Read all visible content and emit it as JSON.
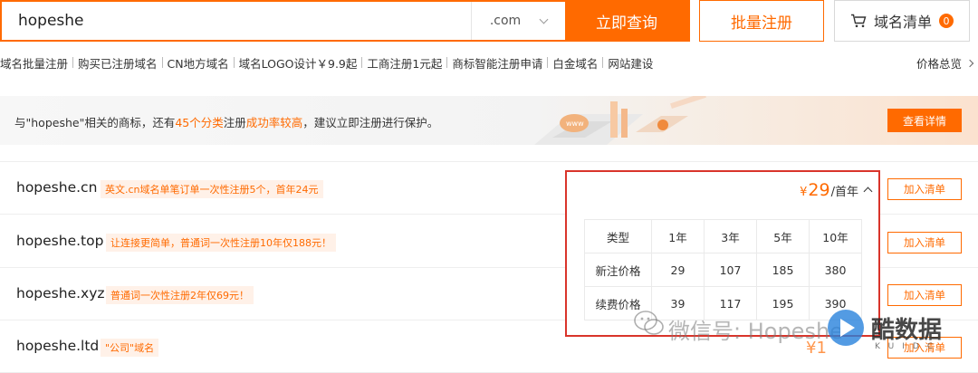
{
  "search": {
    "value": "hopeshe",
    "suffix": ".com",
    "submit_label": "立即查询"
  },
  "header": {
    "batch_label": "批量注册",
    "list_label": "域名清单",
    "list_count": "0"
  },
  "nav": {
    "items": [
      "域名批量注册",
      "购买已注册域名",
      "CN地方域名",
      "域名LOGO设计￥9.9起",
      "工商注册1元起",
      "商标智能注册申请",
      "白金域名",
      "网站建设"
    ],
    "price_overview": "价格总览"
  },
  "banner": {
    "text_before": "与\"hopeshe\"相关的商标，还有",
    "highlight1": "45个分类",
    "text_mid": "注册",
    "highlight2": "成功率较高",
    "text_after": "，建议立即注册进行保护。",
    "art_label": "www",
    "button_label": "查看详情"
  },
  "rows": [
    {
      "domain": "hopeshe.cn",
      "tag": "英文.cn域名单笔订单一次性注册5个，首年24元",
      "add_label": "加入清单"
    },
    {
      "domain": "hopeshe.top",
      "tag": "让连接更简单，普通词一次性注册10年仅188元！",
      "add_label": "加入清单"
    },
    {
      "domain": "hopeshe.xyz",
      "tag": "普通词一次性注册2年仅69元！",
      "add_label": "加入清单"
    },
    {
      "domain": "hopeshe.ltd",
      "tag": "\"公司\"域名",
      "add_label": "加入清单"
    }
  ],
  "price_popup": {
    "currency": "¥",
    "amount": "29",
    "unit": "/首年",
    "table": {
      "headers": [
        "类型",
        "1年",
        "3年",
        "5年",
        "10年"
      ],
      "rows": [
        {
          "label": "新注价格",
          "values": [
            "29",
            "107",
            "185",
            "380"
          ]
        },
        {
          "label": "续费价格",
          "values": [
            "39",
            "117",
            "195",
            "390"
          ]
        }
      ]
    }
  },
  "watermark": {
    "text": "微信号: Hopeshe",
    "brand": "酷数据",
    "sub": "KUIDC"
  },
  "bottom_price": "¥1"
}
